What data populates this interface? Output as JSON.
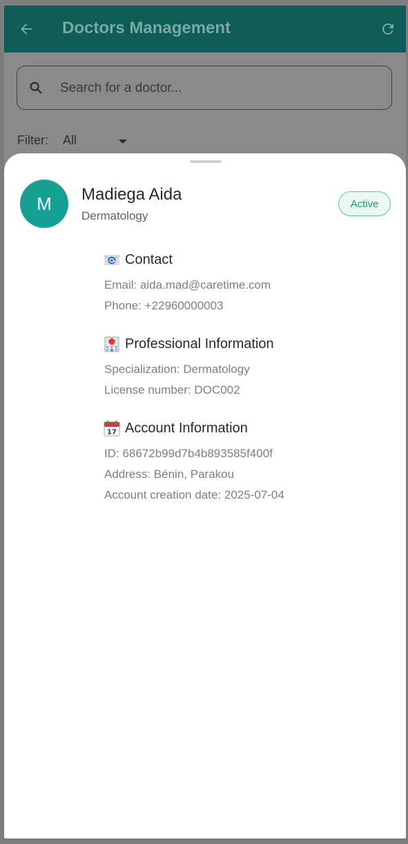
{
  "appbar": {
    "title": "Doctors Management",
    "back_icon": "arrow-left-icon",
    "refresh_icon": "refresh-icon"
  },
  "search": {
    "placeholder": "Search for a doctor...",
    "icon": "search-icon"
  },
  "filter": {
    "label": "Filter:",
    "value": "All"
  },
  "doctor": {
    "initial": "M",
    "name": "Madiega Aida",
    "specialty": "Dermatology",
    "status": "Active"
  },
  "sections": {
    "contact": {
      "title": "Contact",
      "icon": "email-icon",
      "email": "Email: aida.mad@caretime.com",
      "phone": "Phone: +22960000003"
    },
    "professional": {
      "title": "Professional Information",
      "icon": "hospital-icon",
      "specialization": "Specialization: Dermatology",
      "license": "License number: DOC002"
    },
    "account": {
      "title": "Account Information",
      "icon": "calendar-icon",
      "id": "ID: 68672b99d7b4b893585f400f",
      "address": "Address: Bénin, Parakou",
      "created": "Account creation date: 2025-07-04"
    }
  },
  "colors": {
    "primary": "#16a093",
    "appbar_dimmed": "#0d5c55",
    "status_active": "#1e9a6b",
    "overlay": "#8a8a8a"
  }
}
